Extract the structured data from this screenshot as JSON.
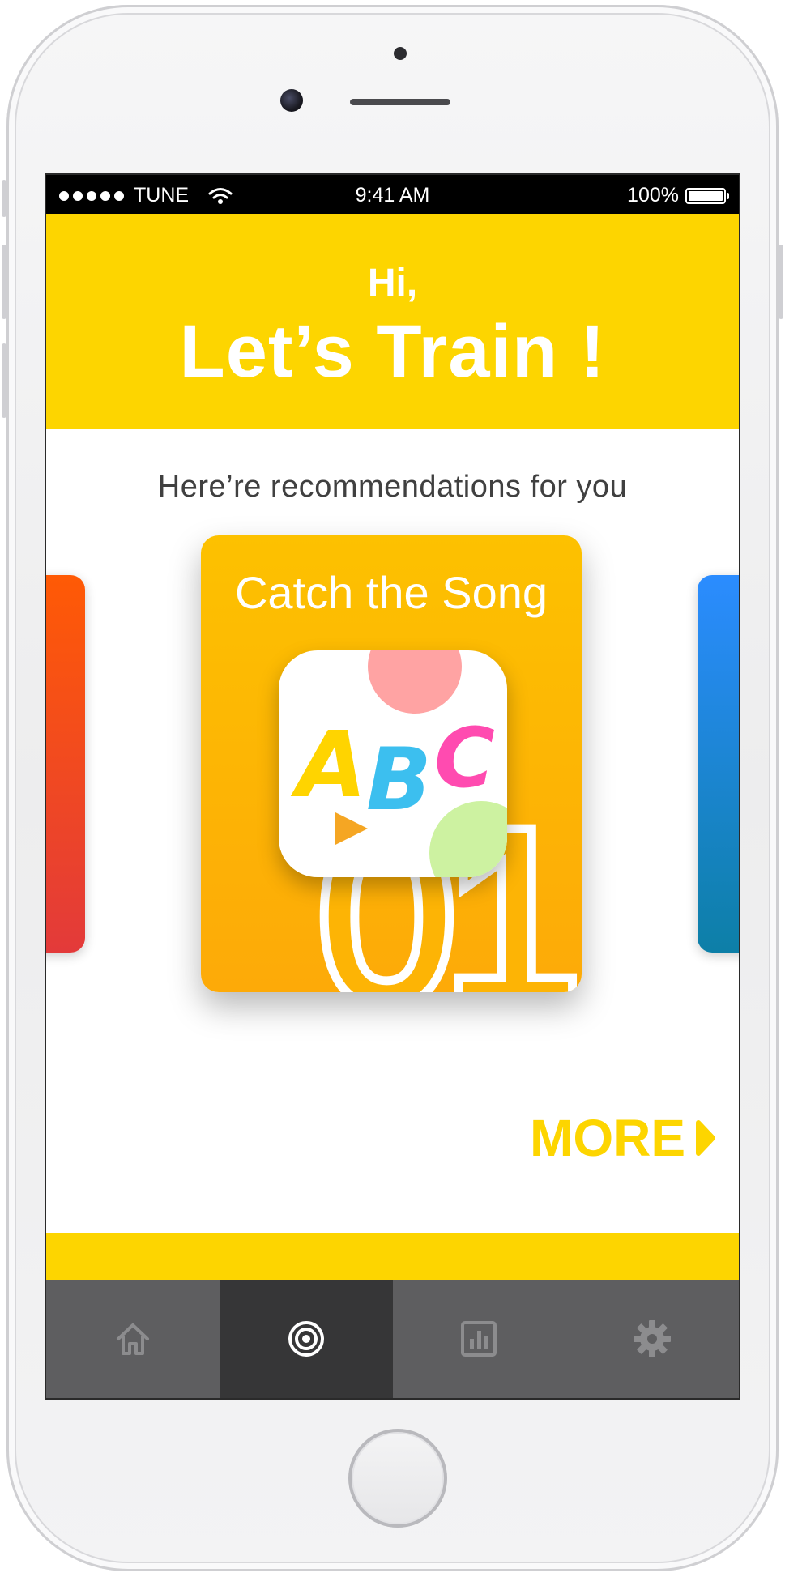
{
  "status_bar": {
    "carrier": "TUNE",
    "time": "9:41 AM",
    "battery": "100%"
  },
  "header": {
    "greeting": "Hi,",
    "headline": "Let’s Train !"
  },
  "recommendations": {
    "subtitle": "Here’re recommendations for you",
    "card": {
      "title": "Catch the Song",
      "number": "01",
      "icon": "abc-app-icon",
      "icon_letters": [
        "A",
        "B",
        "C"
      ]
    }
  },
  "more_label": "MORE",
  "tabs": [
    {
      "name": "home",
      "icon": "home-icon",
      "active": false
    },
    {
      "name": "train",
      "icon": "target-icon",
      "active": true
    },
    {
      "name": "stats",
      "icon": "chart-icon",
      "active": false
    },
    {
      "name": "settings",
      "icon": "gear-icon",
      "active": false
    }
  ],
  "colors": {
    "primary_yellow": "#fdd500",
    "card_orange": "#fdb405",
    "tab_bar": "#5e5e60",
    "tab_active": "#363637",
    "left_card": "#ff5a05",
    "right_card": "#2b8cff"
  }
}
